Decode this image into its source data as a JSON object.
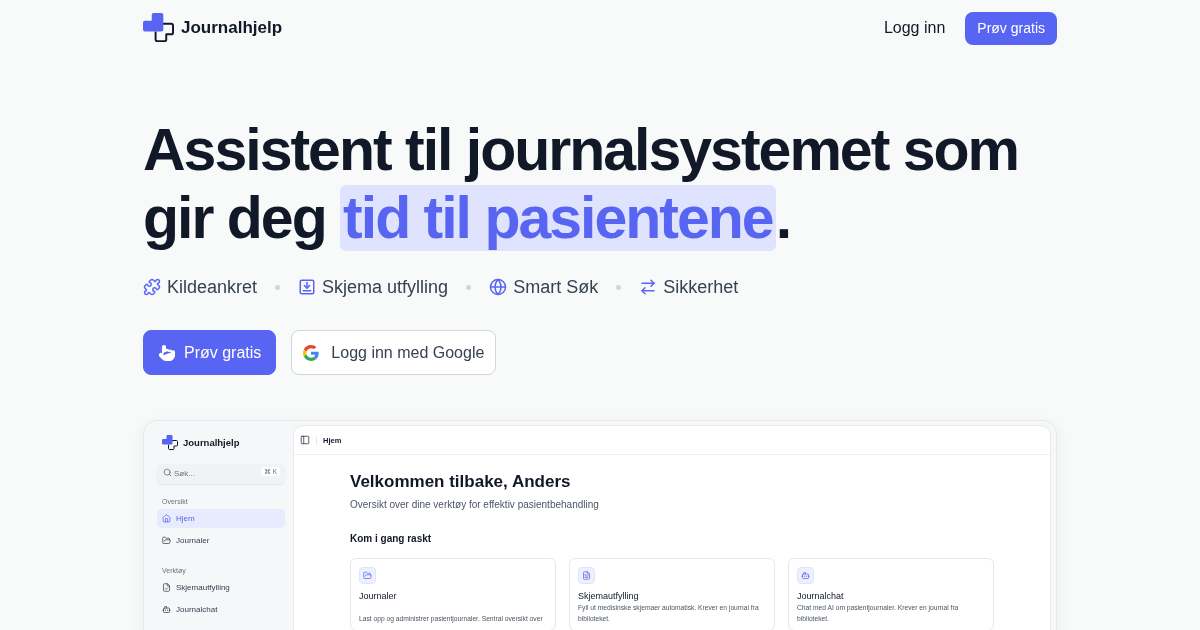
{
  "header": {
    "brand": "Journalhjelp",
    "login_link": "Logg inn",
    "cta_button": "Prøv gratis"
  },
  "hero": {
    "headline": "Assistent til journalsystemet som gir deg",
    "highlight": "tid til pasientene",
    "headline_end": ".",
    "features": [
      {
        "kind": "puzzle",
        "label": "Kildeankret"
      },
      {
        "kind": "form",
        "label": "Skjema utfylling"
      },
      {
        "kind": "globe",
        "label": "Smart Søk"
      },
      {
        "kind": "arrows",
        "label": "Sikkerhet"
      }
    ],
    "buttons": [
      {
        "kind": "primary",
        "label": "Prøv gratis"
      },
      {
        "kind": "google",
        "label": "Logg inn med Google"
      }
    ]
  },
  "app_preview": {
    "sidebar": {
      "brand": "Journalhjelp",
      "search": {
        "placeholder": "Søk...",
        "shortcut": "⌘ K"
      },
      "sections": [
        {
          "title": "Oversikt",
          "items": [
            {
              "kind": "home",
              "label": "Hjem",
              "selected": true
            },
            {
              "kind": "folder",
              "label": "Journaler",
              "selected": false
            }
          ]
        },
        {
          "title": "Verktøy",
          "items": [
            {
              "kind": "form",
              "label": "Skjemautfylling",
              "selected": false
            },
            {
              "kind": "chat",
              "label": "Journalchat",
              "selected": false
            }
          ]
        }
      ]
    },
    "topbar": {
      "breadcrumb": "Hjem"
    },
    "main": {
      "title": "Velkommen tilbake, Anders",
      "subtitle": "Oversikt over dine verktøy for effektiv pasientbehandling",
      "section_title": "Kom i gang raskt",
      "cards": [
        {
          "kind": "folder",
          "title": "Journaler",
          "description": "Last opp og administrer pasientjournaler. Sentral oversikt over"
        },
        {
          "kind": "document",
          "title": "Skjemautfylling",
          "description": "Fyll ut medisinske skjemaer automatisk. Krever en journal fra biblioteket."
        },
        {
          "kind": "chat",
          "title": "Journalchat",
          "description": "Chat med AI om pasientjournaler. Krever en journal fra biblioteket."
        }
      ]
    }
  }
}
